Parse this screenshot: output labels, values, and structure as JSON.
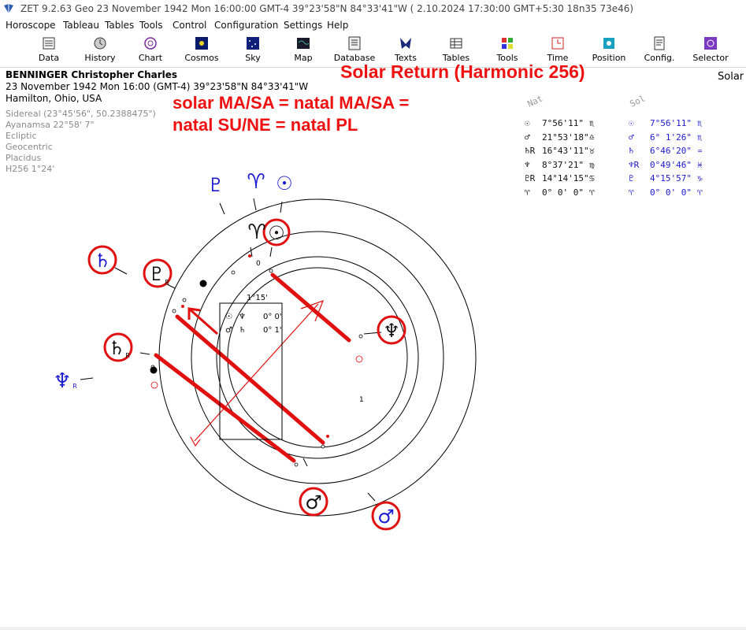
{
  "window": {
    "title": "ZET 9.2.63 Geo   23 November 1942  Mon  16:00:00 GMT-4 39°23'58\"N  84°33'41\"W   ( 2.10.2024  17:30:00 GMT+5:30 18n35 73e46)"
  },
  "menu": [
    "Horoscope",
    "Tableau",
    "Tables",
    "Tools",
    "Control",
    "Configuration",
    "Settings",
    "Help"
  ],
  "toolbar": [
    {
      "label": "Data",
      "icon": "data-icon"
    },
    {
      "label": "History",
      "icon": "history-icon"
    },
    {
      "label": "Chart",
      "icon": "chart-icon"
    },
    {
      "label": "Cosmos",
      "icon": "cosmos-icon"
    },
    {
      "label": "Sky",
      "icon": "sky-icon"
    },
    {
      "label": "Map",
      "icon": "map-icon"
    },
    {
      "label": "Database",
      "icon": "database-icon"
    },
    {
      "label": "Texts",
      "icon": "texts-icon"
    },
    {
      "label": "Tables",
      "icon": "tables-icon"
    },
    {
      "label": "Tools",
      "icon": "tools-icon"
    },
    {
      "label": "Time",
      "icon": "time-icon"
    },
    {
      "label": "Position",
      "icon": "position-icon"
    },
    {
      "label": "Config.",
      "icon": "config-icon"
    },
    {
      "label": "Selector",
      "icon": "selector-icon"
    }
  ],
  "person": {
    "name": "BENNINGER Christopher Charles",
    "datetime": "23 November 1942  Mon  16:00 (GMT-4)  39°23'58\"N  84°33'41\"W",
    "place": "Hamilton, Ohio, USA"
  },
  "settings": [
    "Sidereal (23°45'56\", 50.2388475\")",
    "Ayanamsa 22°58' 7\"",
    "Ecliptic",
    "Geocentric",
    "Placidus",
    "H256   1°24'"
  ],
  "chart_type_label": "Solar",
  "annotation": {
    "title": "Solar Return (Harmonic 256)",
    "line1": "solar MA/SA = natal MA/SA =",
    "line2": "natal SU/NE = natal PL"
  },
  "center_box": {
    "orb": "1°15'",
    "rows": [
      {
        "a": "☉",
        "b": "♆",
        "val": "0° 0'"
      },
      {
        "a": "♂",
        "b": "♄",
        "val": "0° 1'"
      }
    ]
  },
  "ring_labels": {
    "zero_top": "0",
    "one_right": "1"
  },
  "table": {
    "header_nat": "Nat",
    "header_sol": "Sol",
    "rows": [
      {
        "ng": "☉",
        "nv": "7°56'11\"",
        "ns": "♏",
        "sg": "☉",
        "sv": "7°56'11\"",
        "ss": "♏"
      },
      {
        "ng": "♂",
        "nv": "21°53'18\"",
        "ns": "♎",
        "sg": "♂",
        "sv": "6° 1'26\"",
        "ss": "♏"
      },
      {
        "ng": "♄R",
        "nv": "16°43'11\"",
        "ns": "♉",
        "sg": "♄",
        "sv": "6°46'20\"",
        "ss": "♒"
      },
      {
        "ng": "♆",
        "nv": "8°37'21\"",
        "ns": "♍",
        "sg": "♆R",
        "sv": "0°49'46\"",
        "ss": "♓"
      },
      {
        "ng": "♇R",
        "nv": "14°14'15\"",
        "ns": "♋",
        "sg": "♇",
        "sv": "4°15'57\"",
        "ss": "♑"
      },
      {
        "ng": "♈",
        "nv": "0° 0' 0\"",
        "ns": "♈",
        "sg": "♈",
        "sv": "0° 0' 0\"",
        "ss": "♈"
      }
    ]
  },
  "planet_glyphs": {
    "sol_pluto": "♇",
    "sol_aries": "♈",
    "sol_sun": "☉",
    "nat_aries": "♈",
    "nat_sun": "☉",
    "sol_saturn": "♄",
    "nat_pluto": "♇",
    "nat_pluto_r": "R",
    "nat_saturn": "♄",
    "nat_saturn_r": "R",
    "sol_neptune": "♆",
    "sol_neptune_r": "R",
    "nat_neptune": "♆",
    "nat_mars": "♂",
    "sol_mars": "♂"
  },
  "colors": {
    "natal": "#111111",
    "solar": "#1a1ad0",
    "highlight": "#e01010"
  }
}
